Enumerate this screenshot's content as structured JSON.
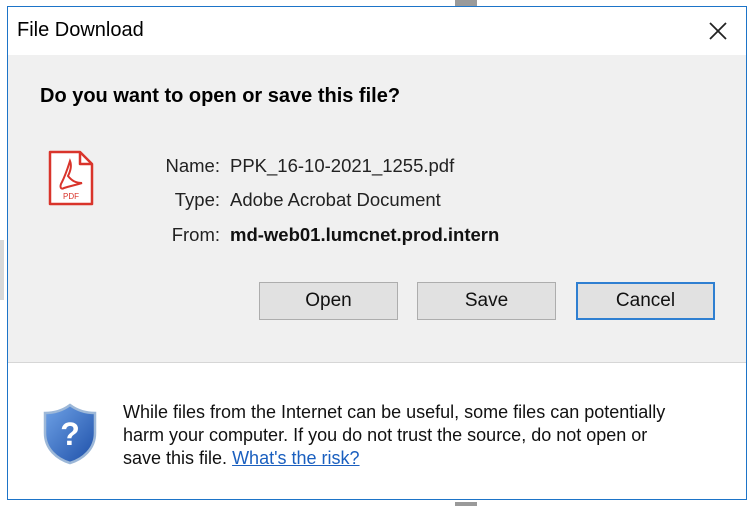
{
  "dialog": {
    "title": "File Download",
    "close_icon": "close-icon",
    "question": "Do you want to open or save this file?",
    "file_icon": "pdf-file-icon",
    "file_icon_text": "PDF",
    "info": {
      "name_label": "Name:",
      "name_value": "PPK_16-10-2021_1255.pdf",
      "type_label": "Type:",
      "type_value": "Adobe Acrobat Document",
      "from_label": "From:",
      "from_value": "md-web01.lumcnet.prod.intern"
    },
    "buttons": {
      "open": "Open",
      "save": "Save",
      "cancel": "Cancel"
    },
    "warning": {
      "icon": "shield-question-icon",
      "line1": "While files from the Internet can be useful, some files can potentially",
      "line2": "harm your computer. If you do not trust the source, do not open or",
      "line3_prefix": "save this file.",
      "link": "What's the risk?"
    }
  },
  "colors": {
    "dialog_border": "#1d74c8",
    "default_button_border": "#2f7fd1",
    "link": "#1a5fbf",
    "pdf_red": "#d9342b",
    "shield_blue": "#2a5fb8"
  }
}
